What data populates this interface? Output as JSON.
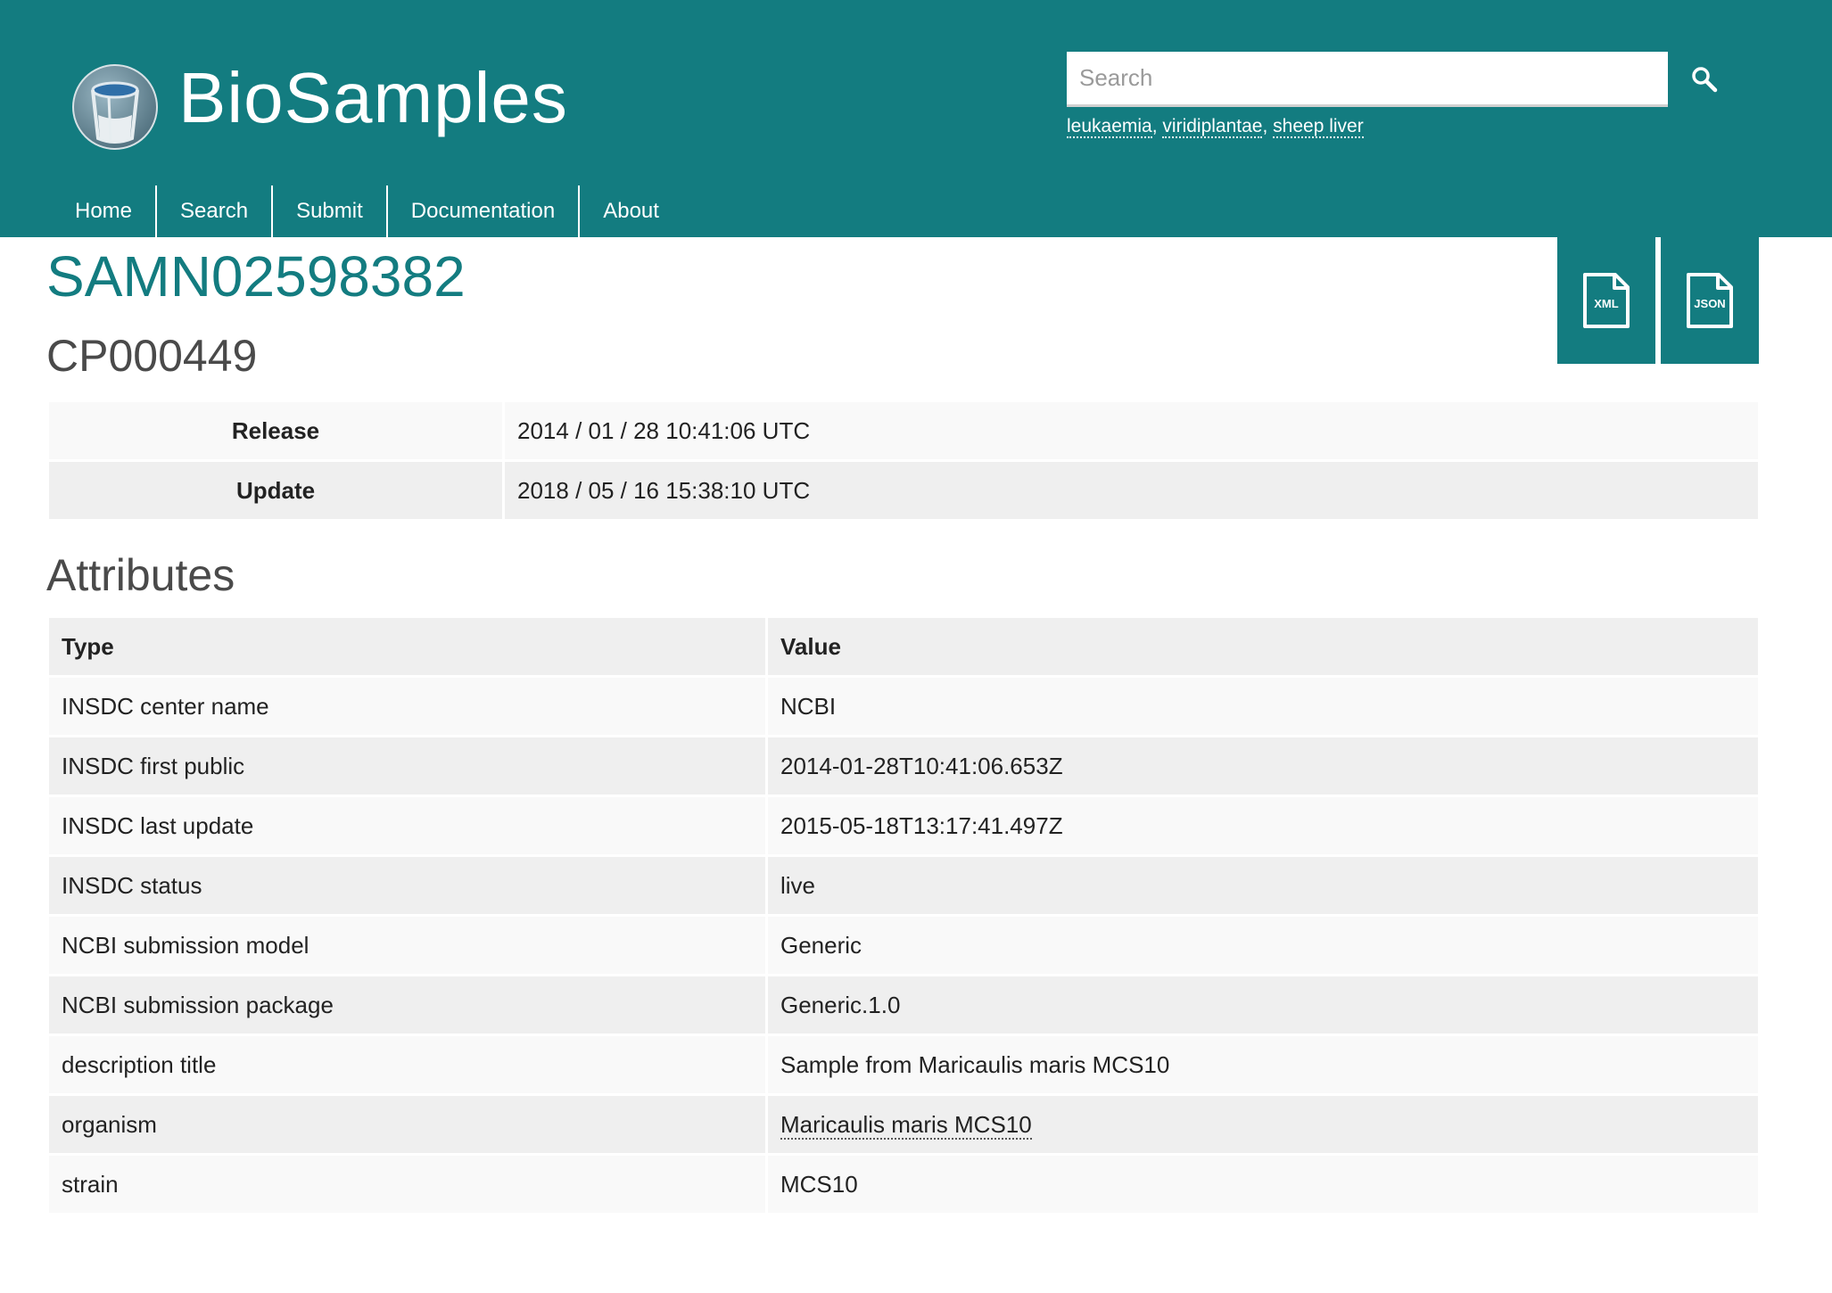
{
  "header": {
    "brand": "BioSamples",
    "search_placeholder": "Search",
    "examples": [
      "leukaemia",
      "viridiplantae",
      "sheep liver"
    ],
    "example_separator": ", ",
    "bg_color": "#137c80"
  },
  "nav": {
    "items": [
      "Home",
      "Search",
      "Submit",
      "Documentation",
      "About"
    ]
  },
  "sample": {
    "accession": "SAMN02598382",
    "name": "CP000449",
    "downloads": [
      "XML",
      "JSON"
    ]
  },
  "dates": [
    {
      "label": "Release",
      "value": "2014 / 01 / 28 10:41:06 UTC"
    },
    {
      "label": "Update",
      "value": "2018 / 05 / 16 15:38:10 UTC"
    }
  ],
  "attributes": {
    "heading": "Attributes",
    "columns": [
      "Type",
      "Value"
    ],
    "rows": [
      {
        "type": "INSDC center name",
        "value": "NCBI"
      },
      {
        "type": "INSDC first public",
        "value": "2014-01-28T10:41:06.653Z"
      },
      {
        "type": "INSDC last update",
        "value": "2015-05-18T13:17:41.497Z"
      },
      {
        "type": "INSDC status",
        "value": "live"
      },
      {
        "type": "NCBI submission model",
        "value": "Generic"
      },
      {
        "type": "NCBI submission package",
        "value": "Generic.1.0"
      },
      {
        "type": "description title",
        "value": "Sample from Maricaulis maris MCS10"
      },
      {
        "type": "organism",
        "value": "Maricaulis maris MCS10"
      },
      {
        "type": "strain",
        "value": "MCS10"
      }
    ]
  },
  "icons": {
    "logo": "sample-tube-logo",
    "search": "search-icon",
    "xml": "xml-file-icon",
    "json": "json-file-icon"
  }
}
